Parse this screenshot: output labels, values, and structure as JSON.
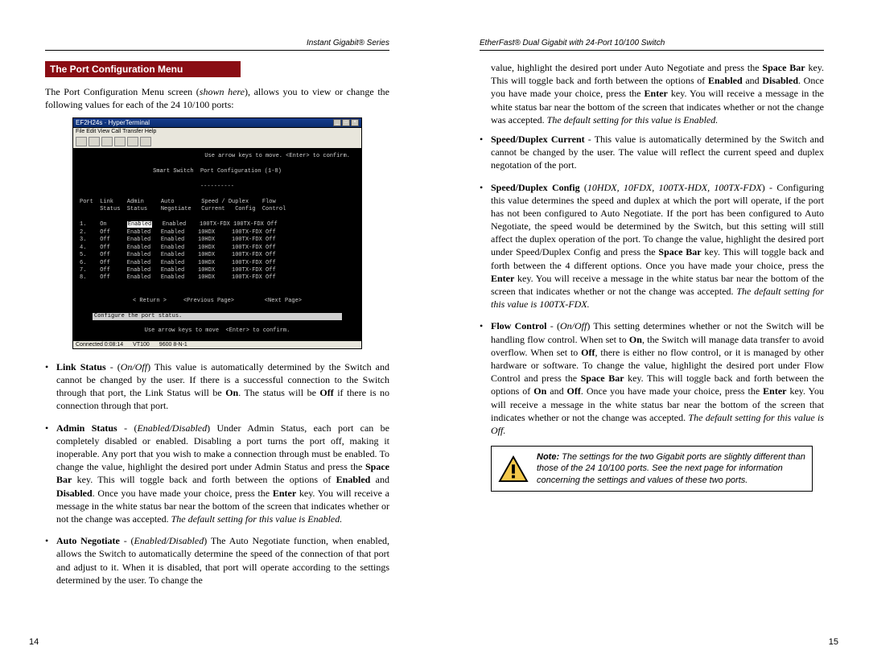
{
  "left": {
    "series_header": "Instant Gigabit® Series",
    "section_title": "The Port Configuration Menu",
    "intro_a": "The Port Configuration Menu screen (",
    "intro_b": "shown here",
    "intro_c": "), allows you to view or change the following values for each of the 24 10/100 ports:",
    "terminal": {
      "title": "EF2H24s · HyperTerminal",
      "menu": "File  Edit  View  Call  Transfer  Help",
      "hint_top": "Use arrow keys to move. <Enter> to confirm.",
      "screen_title": "Smart Switch  Port Configuration (1-8)",
      "divider": "----------",
      "headers": "Port  Link    Admin     Auto        Speed / Duplex    Flow\n      Status  Status    Negotiate   Current   Config  Control",
      "rows": [
        "1.    On      Enabled   Enabled    100TX-FDX 100TX-FDX Off",
        "2.    Off     Enabled   Enabled    10HDX     100TX-FDX Off",
        "3.    Off     Enabled   Enabled    10HDX     100TX-FDX Off",
        "4.    Off     Enabled   Enabled    10HDX     100TX-FDX Off",
        "5.    Off     Enabled   Enabled    10HDX     100TX-FDX Off",
        "6.    Off     Enabled   Enabled    10HDX     100TX-FDX Off",
        "7.    Off     Enabled   Enabled    10HDX     100TX-FDX Off",
        "8.    Off     Enabled   Enabled    10HDX     100TX-FDX Off"
      ],
      "nav": "< Return >     <Previous Page>         <Next Page>",
      "cfg": "Configure the port status.",
      "hint_bottom": "Use arrow keys to move  <Enter> to confirm.",
      "statusbar": [
        "Connected 0:08:14",
        "VT100",
        "9600 8-N-1"
      ]
    },
    "bullets": {
      "b1": {
        "label": "Link Status",
        "opts": "On/Off",
        "rest1": "  This value is automatically determined by the Switch and cannot be changed by the user.  If there is a successful connection to the Switch through that port, the Link Status will be ",
        "on": "On",
        "rest2": ".  The status will be ",
        "off": "Off",
        "rest3": " if there is no connection through that port."
      },
      "b2": {
        "label": "Admin Status",
        "opts": "Enabled/Disabled",
        "rest1": "  Under Admin Status, each port can be completely disabled or enabled.  Disabling a port turns the port off, making it inoperable.  Any port that you wish to make a connection through must be enabled.  To change the value, highlight the desired port under Admin Status and press the ",
        "key1": "Space Bar",
        "rest2": " key.  This will toggle back and forth between the options of ",
        "en": "Enabled",
        "and": " and ",
        "dis": "Disabled",
        "rest3": ".  Once you have made your choice, press the ",
        "key2": "Enter",
        "rest4": " key.  You will receive a message in the white status bar near the bottom of the screen that indicates whether or not the change was accepted.  ",
        "defit": "The default setting for this value is Enabled."
      },
      "b3": {
        "label": "Auto Negotiate",
        "opts": "Enabled/Disabled",
        "rest1": "  The Auto Negotiate function, when enabled,  allows the Switch to automatically determine the speed of the connection of that port and adjust to it.  When it is disabled, that port will operate according to the settings determined by the user.  To change the"
      }
    },
    "page_no": "14"
  },
  "right": {
    "series_header": "EtherFast® Dual Gigabit with 24-Port 10/100 Switch",
    "cont": {
      "p1a": "value, highlight the desired port under Auto Negotiate and press the ",
      "p1k1": "Space Bar",
      "p1b": " key.  This will toggle back and forth between the options of ",
      "p1en": "Enabled",
      "p1and": " and ",
      "p1dis": "Disabled",
      "p1c": ".  Once you have made your choice, press the ",
      "p1k2": "Enter",
      "p1d": " key.  You will receive a message in the white status bar near the bottom of the screen that indicates whether or not the change was accepted.  ",
      "p1def": "The default setting for this value is Enabled."
    },
    "bullets": {
      "b1": {
        "label": "Speed/Duplex Current",
        "rest": " - This value is automatically determined by the Switch and cannot be changed by the user.  The value will reflect the current speed and duplex negotation of the port."
      },
      "b2": {
        "label": "Speed/Duplex Config",
        "opts": "10HDX, 10FDX, 100TX-HDX, 100TX-FDX",
        "rest1": " - Configuring this value determines the speed and duplex at which the port will operate, if the port has not been configured to Auto Negotiate.  If the port has been configured to Auto Negotiate, the speed would be determined by the Switch, but this setting will still affect the duplex operation of the port. To change the value, highlight the desired port under Speed/Duplex Config and press the ",
        "key1": "Space Bar",
        "rest2": " key.  This will toggle back and forth between the 4 different options.  Once you have made your choice, press the ",
        "key2": "Enter",
        "rest3": " key.  You will receive a message in the white status bar near the bottom of the screen that indicates whether or not the change was accepted.  ",
        "defit": "The default setting for this value is 100TX-FDX."
      },
      "b3": {
        "label": "Flow Control",
        "opts": "On/Off",
        "rest1": " This setting determines whether or not the Switch will be handling flow control.  When set to ",
        "on": "On",
        "rest2": ", the Switch will manage data transfer to avoid overflow.  When set to ",
        "off": "Off",
        "rest3": ", there is either no flow control, or it is managed by other hardware or software. To change the value, highlight the desired port under Flow Control and press the ",
        "key1": "Space Bar",
        "rest4": " key.  This will toggle back and forth between the options of ",
        "onb": "On",
        "and": " and ",
        "offb": "Off",
        "rest5": ".  Once you have made your choice, press the ",
        "key2": "Enter",
        "rest6": " key.  You will receive a message in the white status bar near the bottom of the screen that indicates whether or not the change was accepted.  ",
        "defit": "The default setting for this value is Off."
      }
    },
    "note": {
      "label": "Note:",
      "text": " The settings for the two Gigabit ports are slightly different than those of the 24 10/100 ports. See the next page for information concerning the settings and values of these two ports."
    },
    "page_no": "15"
  }
}
